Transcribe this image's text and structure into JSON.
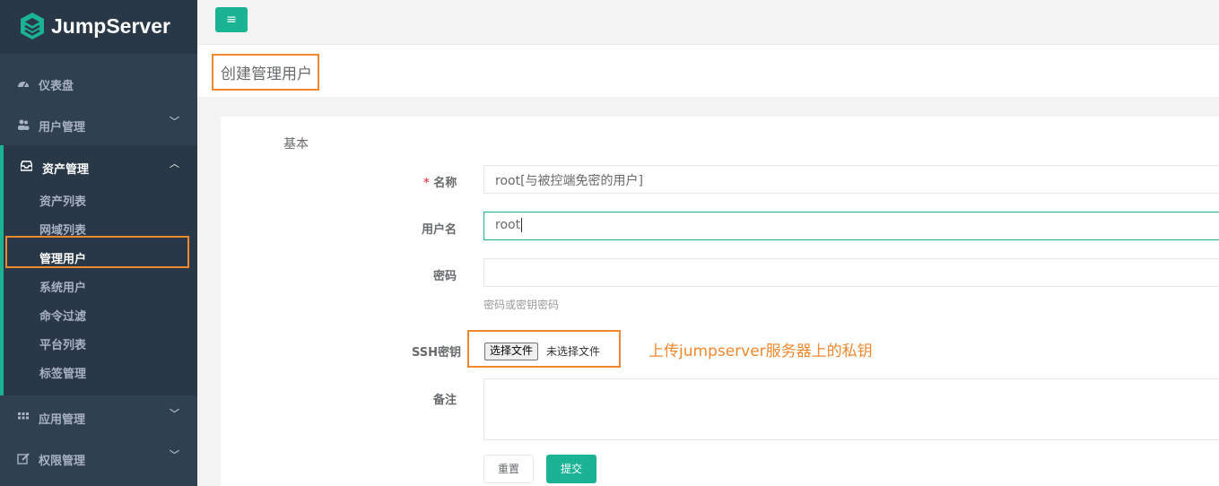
{
  "brand": {
    "name": "JumpServer"
  },
  "sidebar": {
    "items": [
      {
        "label": "仪表盘",
        "icon": "dashboard-icon"
      },
      {
        "label": "用户管理",
        "icon": "users-icon"
      },
      {
        "label": "资产管理",
        "icon": "inbox-icon",
        "expanded": true
      },
      {
        "label": "应用管理",
        "icon": "grid-icon"
      },
      {
        "label": "权限管理",
        "icon": "edit-icon"
      }
    ],
    "asset_subitems": [
      {
        "label": "资产列表"
      },
      {
        "label": "网域列表"
      },
      {
        "label": "管理用户",
        "active": true
      },
      {
        "label": "系统用户"
      },
      {
        "label": "命令过滤"
      },
      {
        "label": "平台列表"
      },
      {
        "label": "标签管理"
      }
    ]
  },
  "page": {
    "title": "创建管理用户"
  },
  "form": {
    "section": "基本",
    "name": {
      "label": "名称",
      "required_mark": "*",
      "value": "root[与被控端免密的用户]"
    },
    "username": {
      "label": "用户名",
      "value": "root"
    },
    "password": {
      "label": "密码",
      "value": "",
      "help": "密码或密钥密码"
    },
    "ssh_key": {
      "label": "SSH密钥",
      "button": "选择文件",
      "status": "未选择文件"
    },
    "comment": {
      "label": "备注",
      "value": ""
    },
    "reset_label": "重置",
    "submit_label": "提交"
  },
  "annotation": "上传jumpserver服务器上的私钥",
  "colors": {
    "accent": "#1ab394",
    "sidebar": "#2f4050",
    "highlight": "#f0882f"
  }
}
